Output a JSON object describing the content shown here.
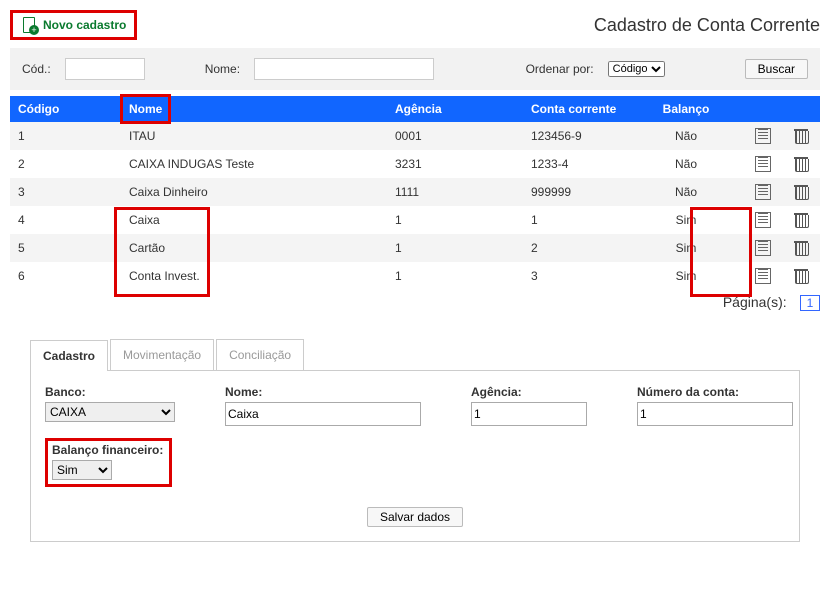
{
  "header": {
    "novo_cadastro_label": "Novo cadastro",
    "title": "Cadastro de Conta Corrente"
  },
  "filter": {
    "cod_label": "Cód.:",
    "cod_value": "",
    "nome_label": "Nome:",
    "nome_value": "",
    "ordenar_label": "Ordenar por:",
    "ordenar_selected": "Código",
    "buscar_label": "Buscar"
  },
  "table": {
    "headers": {
      "codigo": "Código",
      "nome": "Nome",
      "agencia": "Agência",
      "conta": "Conta corrente",
      "balanco": "Balanço"
    },
    "rows": [
      {
        "codigo": "1",
        "nome": "ITAU",
        "agencia": "0001",
        "conta": "123456-9",
        "balanco": "Não"
      },
      {
        "codigo": "2",
        "nome": "CAIXA INDUGAS Teste",
        "agencia": "3231",
        "conta": "1233-4",
        "balanco": "Não"
      },
      {
        "codigo": "3",
        "nome": "Caixa Dinheiro",
        "agencia": "1111",
        "conta": "999999",
        "balanco": "Não"
      },
      {
        "codigo": "4",
        "nome": "Caixa",
        "agencia": "1",
        "conta": "1",
        "balanco": "Sim"
      },
      {
        "codigo": "5",
        "nome": "Cartão",
        "agencia": "1",
        "conta": "2",
        "balanco": "Sim"
      },
      {
        "codigo": "6",
        "nome": "Conta Invest.",
        "agencia": "1",
        "conta": "3",
        "balanco": "Sim"
      }
    ]
  },
  "pagination": {
    "label": "Página(s):",
    "current": "1"
  },
  "tabs": {
    "cadastro": "Cadastro",
    "movimentacao": "Movimentação",
    "conciliacao": "Conciliação"
  },
  "form": {
    "banco_label": "Banco:",
    "banco_value": "CAIXA",
    "nome_label": "Nome:",
    "nome_value": "Caixa",
    "agencia_label": "Agência:",
    "agencia_value": "1",
    "numero_label": "Número da conta:",
    "numero_value": "1",
    "balanco_label": "Balanço financeiro:",
    "balanco_value": "Sim",
    "salvar_label": "Salvar dados"
  }
}
